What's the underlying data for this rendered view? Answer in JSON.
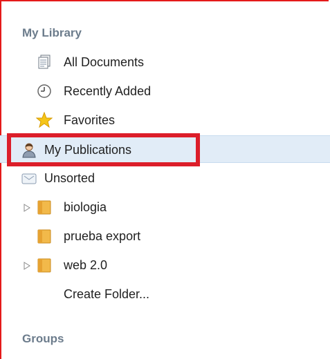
{
  "library": {
    "title": "My Library",
    "items": [
      {
        "label": "All Documents",
        "icon": "documents-icon"
      },
      {
        "label": "Recently Added",
        "icon": "clock-icon"
      },
      {
        "label": "Favorites",
        "icon": "star-icon"
      },
      {
        "label": "My Publications",
        "icon": "user-icon",
        "selected": true
      },
      {
        "label": "Unsorted",
        "icon": "tray-icon"
      },
      {
        "label": "biologia",
        "icon": "folder-icon",
        "expandable": true
      },
      {
        "label": "prueba export",
        "icon": "folder-icon"
      },
      {
        "label": "web 2.0",
        "icon": "folder-icon",
        "expandable": true
      },
      {
        "label": "Create Folder...",
        "icon": ""
      }
    ]
  },
  "groups": {
    "title": "Groups"
  },
  "colors": {
    "highlight_border": "#dc1e2a",
    "frame_border": "#e41a1a",
    "selected_row": "#e1ecf7",
    "section_title": "#6c7c8c"
  }
}
